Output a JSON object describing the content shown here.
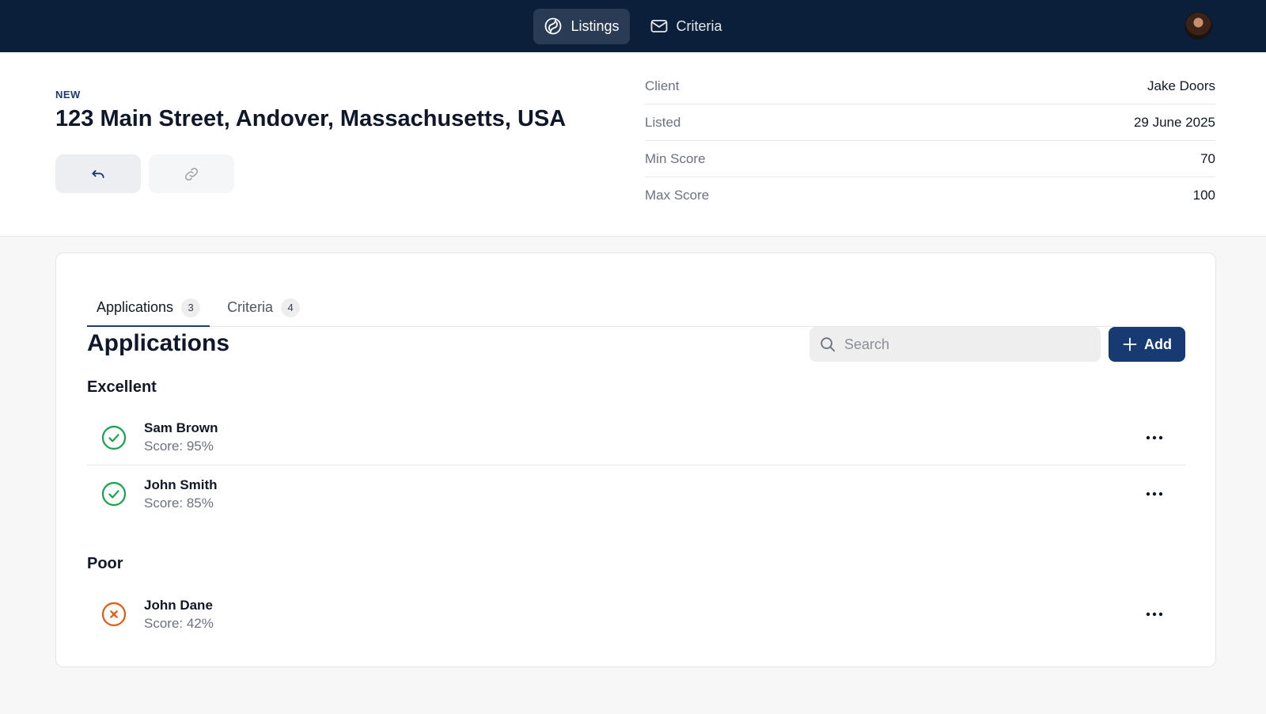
{
  "nav": {
    "items": [
      {
        "label": "Listings",
        "icon": "swirl-icon",
        "active": true
      },
      {
        "label": "Criteria",
        "icon": "mail-icon",
        "active": false
      }
    ]
  },
  "listing": {
    "badge": "NEW",
    "address": "123 Main Street, Andover, Massachusetts, USA"
  },
  "details": {
    "client": {
      "label": "Client",
      "value": "Jake Doors"
    },
    "listed": {
      "label": "Listed",
      "value": "29 June 2025"
    },
    "min_score": {
      "label": "Min Score",
      "value": "70"
    },
    "max_score": {
      "label": "Max Score",
      "value": "100"
    }
  },
  "tabs": [
    {
      "label": "Applications",
      "count": "3",
      "active": true
    },
    {
      "label": "Criteria",
      "count": "4",
      "active": false
    }
  ],
  "applications": {
    "title": "Applications",
    "search_placeholder": "Search",
    "add_label": "Add",
    "groups": {
      "excellent": {
        "title": "Excellent",
        "items": [
          {
            "name": "Sam Brown",
            "score": "Score: 95%",
            "status": "pass"
          },
          {
            "name": "John Smith",
            "score": "Score: 85%",
            "status": "pass"
          }
        ]
      },
      "poor": {
        "title": "Poor",
        "items": [
          {
            "name": "John Dane",
            "score": "Score: 42%",
            "status": "fail"
          }
        ]
      }
    }
  },
  "colors": {
    "navbar": "#0b1f3a",
    "accent": "#173a72",
    "pass": "#16a34a",
    "fail": "#ea580c"
  }
}
